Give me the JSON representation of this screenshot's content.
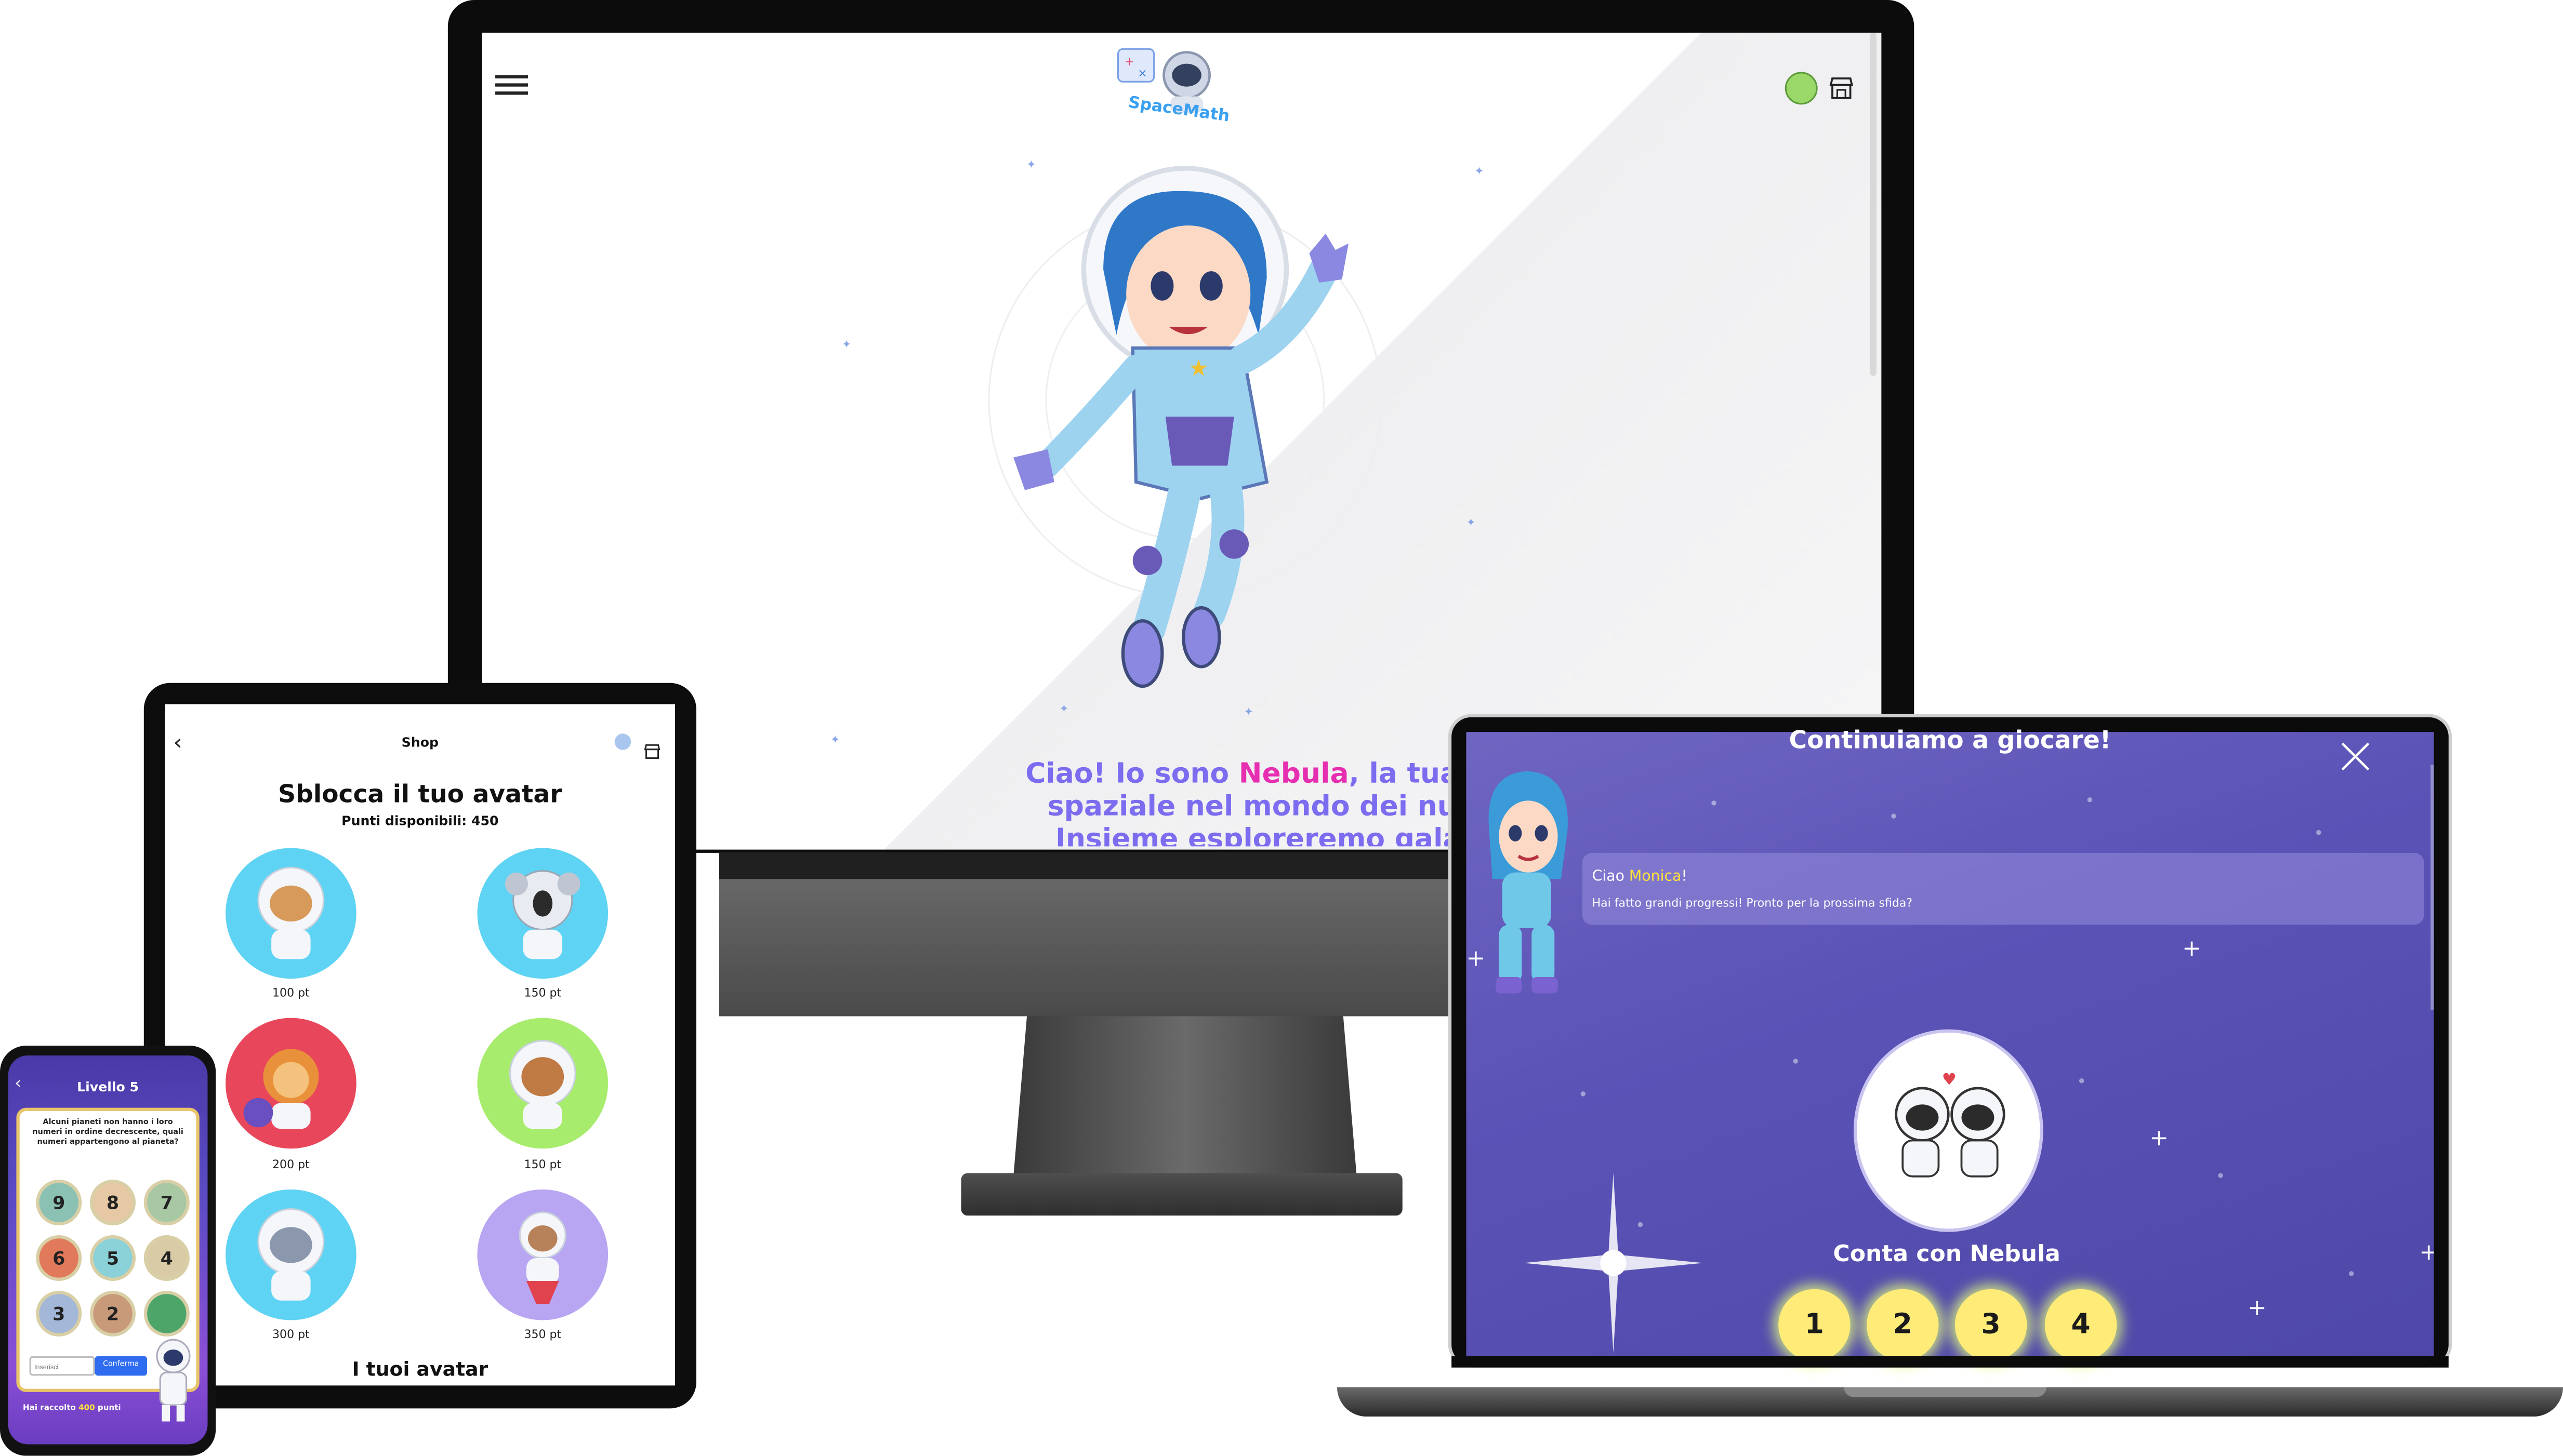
{
  "desktop": {
    "logo_text": "SpaceMath",
    "welcome": {
      "line1_before": "Ciao! Io sono ",
      "line1_name": "Nebula",
      "line1_after": ", la tua gu",
      "line2": "spaziale nel mondo dei num",
      "line3": "Insieme esploreremo galas"
    }
  },
  "tablet": {
    "header_title": "Shop",
    "title": "Sblocca il tuo avatar",
    "points": "Punti disponibili: 450",
    "avatars": [
      {
        "name": "dog-astronaut",
        "price": "100 pt",
        "color": "#5fd3f3"
      },
      {
        "name": "koala-astronaut",
        "price": "150 pt",
        "color": "#5fd3f3"
      },
      {
        "name": "lion-astronaut",
        "price": "200 pt",
        "color": "#e8475b"
      },
      {
        "name": "bear-astronaut",
        "price": "150 pt",
        "color": "#a7ec6c"
      },
      {
        "name": "cat-astronaut",
        "price": "300 pt",
        "color": "#5fd3f3"
      },
      {
        "name": "monkey-astronaut",
        "price": "350 pt",
        "color": "#b8a6f2"
      }
    ],
    "section_title": "I tuoi avatar"
  },
  "phone": {
    "title": "Livello 5",
    "question": "Alcuni pianeti non hanno i loro numeri in ordine decrescente, quali numeri appartengono al pianeta?",
    "planets": [
      "9",
      "8",
      "7",
      "6",
      "5",
      "4",
      "3",
      "2",
      ""
    ],
    "input_placeholder": "Inserisci",
    "confirm_label": "Conferma",
    "footer_before": "Hai raccolto ",
    "footer_points": "400",
    "footer_after": " punti"
  },
  "laptop": {
    "title": "Continuiamo a giocare!",
    "greeting_before": "Ciao ",
    "greeting_name": "Monica",
    "greeting_after": "!",
    "message": "Hai fatto grandi progressi! Pronto per la prossima sfida?",
    "game_title": "Conta con Nebula",
    "numbers": [
      "1",
      "2",
      "3",
      "4"
    ]
  },
  "colors": {
    "accent_purple": "#7b6cf0",
    "highlight_pink": "#e52fb0",
    "highlight_yellow": "#ffe23a",
    "confirm_blue": "#2f6cf0"
  }
}
